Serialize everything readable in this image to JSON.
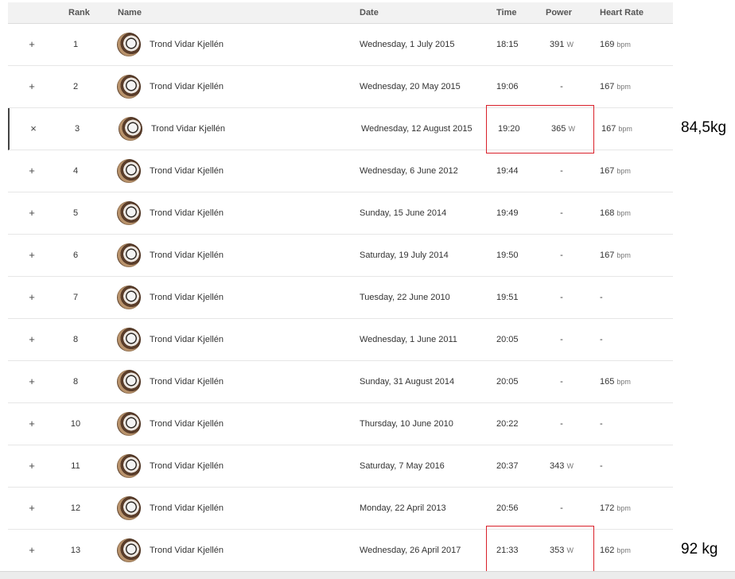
{
  "table": {
    "headers": {
      "rank": "Rank",
      "name": "Name",
      "date": "Date",
      "time": "Time",
      "power": "Power",
      "heart_rate": "Heart Rate"
    },
    "rows": [
      {
        "toggle": "+",
        "rank": "1",
        "name": "Trond Vidar Kjellén",
        "date": "Wednesday, 1 July 2015",
        "time": "18:15",
        "power": "391",
        "power_unit": "W",
        "hr": "169",
        "hr_unit": "bpm"
      },
      {
        "toggle": "+",
        "rank": "2",
        "name": "Trond Vidar Kjellén",
        "date": "Wednesday, 20 May 2015",
        "time": "19:06",
        "power": "-",
        "power_unit": "",
        "hr": "167",
        "hr_unit": "bpm"
      },
      {
        "toggle": "×",
        "rank": "3",
        "name": "Trond Vidar Kjellén",
        "date": "Wednesday, 12 August 2015",
        "time": "19:20",
        "power": "365",
        "power_unit": "W",
        "hr": "167",
        "hr_unit": "bpm",
        "expanded": true
      },
      {
        "toggle": "+",
        "rank": "4",
        "name": "Trond Vidar Kjellén",
        "date": "Wednesday, 6 June 2012",
        "time": "19:44",
        "power": "-",
        "power_unit": "",
        "hr": "167",
        "hr_unit": "bpm"
      },
      {
        "toggle": "+",
        "rank": "5",
        "name": "Trond Vidar Kjellén",
        "date": "Sunday, 15 June 2014",
        "time": "19:49",
        "power": "-",
        "power_unit": "",
        "hr": "168",
        "hr_unit": "bpm"
      },
      {
        "toggle": "+",
        "rank": "6",
        "name": "Trond Vidar Kjellén",
        "date": "Saturday, 19 July 2014",
        "time": "19:50",
        "power": "-",
        "power_unit": "",
        "hr": "167",
        "hr_unit": "bpm"
      },
      {
        "toggle": "+",
        "rank": "7",
        "name": "Trond Vidar Kjellén",
        "date": "Tuesday, 22 June 2010",
        "time": "19:51",
        "power": "-",
        "power_unit": "",
        "hr": "-",
        "hr_unit": ""
      },
      {
        "toggle": "+",
        "rank": "8",
        "name": "Trond Vidar Kjellén",
        "date": "Wednesday, 1 June 2011",
        "time": "20:05",
        "power": "-",
        "power_unit": "",
        "hr": "-",
        "hr_unit": ""
      },
      {
        "toggle": "+",
        "rank": "8",
        "name": "Trond Vidar Kjellén",
        "date": "Sunday, 31 August 2014",
        "time": "20:05",
        "power": "-",
        "power_unit": "",
        "hr": "165",
        "hr_unit": "bpm"
      },
      {
        "toggle": "+",
        "rank": "10",
        "name": "Trond Vidar Kjellén",
        "date": "Thursday, 10 June 2010",
        "time": "20:22",
        "power": "-",
        "power_unit": "",
        "hr": "-",
        "hr_unit": ""
      },
      {
        "toggle": "+",
        "rank": "11",
        "name": "Trond Vidar Kjellén",
        "date": "Saturday, 7 May 2016",
        "time": "20:37",
        "power": "343",
        "power_unit": "W",
        "hr": "-",
        "hr_unit": ""
      },
      {
        "toggle": "+",
        "rank": "12",
        "name": "Trond Vidar Kjellén",
        "date": "Monday, 22 April 2013",
        "time": "20:56",
        "power": "-",
        "power_unit": "",
        "hr": "172",
        "hr_unit": "bpm"
      },
      {
        "toggle": "+",
        "rank": "13",
        "name": "Trond Vidar Kjellén",
        "date": "Wednesday, 26 April 2017",
        "time": "21:33",
        "power": "353",
        "power_unit": "W",
        "hr": "162",
        "hr_unit": "bpm"
      }
    ]
  },
  "annotations": {
    "note_row3": "84,5kg",
    "note_row13": "92 kg",
    "highlight_color": "#d9202a"
  },
  "icons": {
    "expand": "plus-icon",
    "collapse": "close-icon"
  }
}
